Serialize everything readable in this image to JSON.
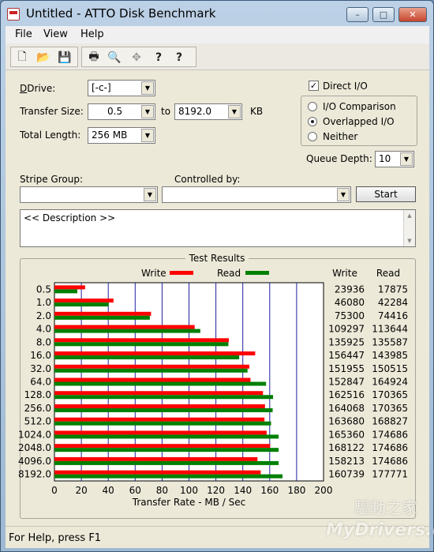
{
  "window": {
    "title": "Untitled - ATTO Disk Benchmark",
    "minimize": "–",
    "maximize": "□",
    "close": "✕"
  },
  "menu": [
    "File",
    "View",
    "Help"
  ],
  "toolbar": {
    "icons": [
      "new-file-icon",
      "open-folder-icon",
      "save-icon",
      "print-icon",
      "print-preview-icon",
      "move-icon",
      "help-icon",
      "context-help-icon"
    ],
    "glyphs": [
      "🗋",
      "📂",
      "💾",
      "🖶",
      "🔍",
      "✥",
      "?",
      "?"
    ]
  },
  "settings": {
    "drive_label": "Drive:",
    "drive_value": "[-c-]",
    "transfer_size_label": "Transfer Size:",
    "transfer_from": "0.5",
    "to_label": "to",
    "transfer_to": "8192.0",
    "kb_label": "KB",
    "total_length_label": "Total Length:",
    "total_length_value": "256 MB",
    "direct_io_label": "Direct I/O",
    "direct_io_checked": true,
    "radio_options": [
      {
        "label": "I/O Comparison",
        "selected": false
      },
      {
        "label": "Overlapped I/O",
        "selected": true
      },
      {
        "label": "Neither",
        "selected": false
      }
    ],
    "queue_depth_label": "Queue Depth:",
    "queue_depth_value": "10",
    "stripe_group_label": "Stripe Group:",
    "stripe_group_value": "",
    "controlled_by_label": "Controlled by:",
    "controlled_by_value": "",
    "start_label": "Start",
    "description": "<< Description >>"
  },
  "chart_data": {
    "type": "bar",
    "title": "Test Results",
    "orientation": "horizontal",
    "categories": [
      "0.5",
      "1.0",
      "2.0",
      "4.0",
      "8.0",
      "16.0",
      "32.0",
      "64.0",
      "128.0",
      "256.0",
      "512.0",
      "1024.0",
      "2048.0",
      "4096.0",
      "8192.0"
    ],
    "series": [
      {
        "name": "Write",
        "color": "#ff0000",
        "values": [
          22.8,
          43.9,
          71.8,
          104.2,
          129.6,
          149.2,
          144.9,
          145.7,
          155.0,
          156.5,
          156.1,
          157.7,
          160.3,
          150.9,
          153.3
        ]
      },
      {
        "name": "Read",
        "color": "#008000",
        "values": [
          17.0,
          40.3,
          70.9,
          108.4,
          129.3,
          137.3,
          143.5,
          157.3,
          162.5,
          162.2,
          161.0,
          166.6,
          166.6,
          166.6,
          169.5
        ]
      }
    ],
    "table": {
      "write_header": "Write",
      "read_header": "Read",
      "write": [
        "23936",
        "46080",
        "75300",
        "109297",
        "135925",
        "156447",
        "151955",
        "152847",
        "162516",
        "164068",
        "163680",
        "165360",
        "168122",
        "158213",
        "160739"
      ],
      "read": [
        "17875",
        "42284",
        "74416",
        "113644",
        "135587",
        "143985",
        "150515",
        "164924",
        "170365",
        "170365",
        "168827",
        "174686",
        "174686",
        "174686",
        "177771"
      ]
    },
    "xlabel": "Transfer Rate - MB / Sec",
    "xlim": [
      0,
      200
    ],
    "xticks": [
      0,
      20,
      40,
      60,
      80,
      100,
      120,
      140,
      160,
      180,
      200
    ],
    "grid": true
  },
  "status": {
    "text": "For Help, press F1"
  },
  "watermark": {
    "line1": "驅動之家",
    "line2": "MyDrivers.com"
  }
}
